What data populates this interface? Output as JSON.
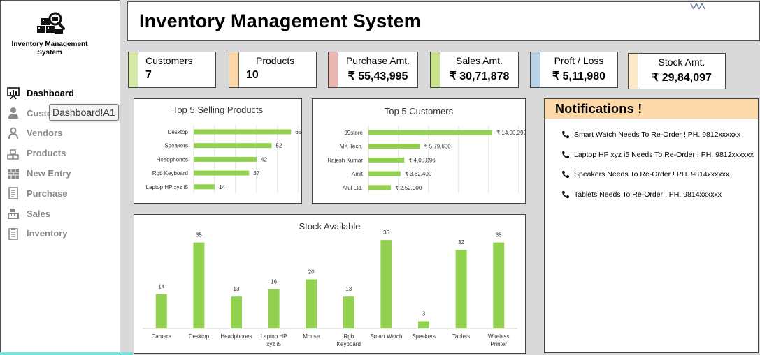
{
  "app": {
    "title": "Inventory Management System",
    "brand": "Inventory Management System"
  },
  "sidebar": {
    "items": [
      {
        "label": "Dashboard",
        "icon": "dashboard-icon",
        "active": true
      },
      {
        "label": "Customers",
        "icon": "person-icon",
        "active": false
      },
      {
        "label": "Vendors",
        "icon": "vendor-icon",
        "active": false
      },
      {
        "label": "Products",
        "icon": "boxes-icon",
        "active": false
      },
      {
        "label": "New Entry",
        "icon": "brick-icon",
        "active": false
      },
      {
        "label": "Purchase",
        "icon": "document-icon",
        "active": false
      },
      {
        "label": "Sales",
        "icon": "cash-register-icon",
        "active": false
      },
      {
        "label": "Inventory",
        "icon": "clipboard-icon",
        "active": false
      }
    ],
    "tooltip": "Dashboard!A1"
  },
  "kpis": [
    {
      "label": "Customers",
      "value": "7",
      "color": "#d6e9a6"
    },
    {
      "label": "Products",
      "value": "10",
      "color": "#fcd8a8"
    },
    {
      "label": "Purchase Amt.",
      "value": "₹ 55,43,995",
      "color": "#ecb7b0"
    },
    {
      "label": "Sales Amt.",
      "value": "₹ 30,71,878",
      "color": "#c9e38b"
    },
    {
      "label": "Proft / Loss",
      "value": "₹ 5,11,980",
      "color": "#b7d1e6"
    },
    {
      "label": "Stock Amt.",
      "value": "₹ 29,84,097",
      "color": "#fde9c8"
    }
  ],
  "notifications": {
    "title": "Notifications !",
    "items": [
      "Smart Watch Needs To Re-Order ! PH. 9812xxxxxx",
      "Laptop HP xyz i5 Needs To Re-Order ! PH. 9812xxxxxx",
      "Speakers Needs To Re-Order ! PH. 9814xxxxxx",
      "Tablets Needs To Re-Order ! PH. 9814xxxxxx"
    ]
  },
  "colors": {
    "bar": "#92d050"
  },
  "chart_data": [
    {
      "type": "bar",
      "orientation": "horizontal",
      "title": "Top 5 Selling Products",
      "categories": [
        "Desktop",
        "Speakers",
        "Headphones",
        "Rgb Keyboard",
        "Laptop HP xyz i5"
      ],
      "values": [
        65,
        52,
        42,
        37,
        14
      ],
      "data_labels": [
        "65",
        "52",
        "42",
        "37",
        "14"
      ],
      "xlim": [
        0,
        70
      ],
      "grid": true
    },
    {
      "type": "bar",
      "orientation": "horizontal",
      "title": "Top 5 Customers",
      "categories": [
        "99store",
        "MK Tech.",
        "Rajesh Kumar",
        "Amit",
        "Atul Ltd."
      ],
      "values": [
        1400292,
        579600,
        405096,
        362400,
        252000
      ],
      "data_labels": [
        "₹ 14,00,292",
        "₹ 5,79,600",
        "₹ 4,05,096",
        "₹ 3,62,400",
        "₹ 2,52,000"
      ],
      "xlim": [
        0,
        1700000
      ],
      "grid": true
    },
    {
      "type": "bar",
      "orientation": "vertical",
      "title": "Stock Available",
      "categories": [
        "Camera",
        "Desktop",
        "Headphones",
        "Laptop HP xyz i5",
        "Mouse",
        "Rgb Keyboard",
        "Smart Watch",
        "Speakers",
        "Tablets",
        "Wireless Printer"
      ],
      "category_lines": [
        [
          "Camera"
        ],
        [
          "Desktop"
        ],
        [
          "Headphones"
        ],
        [
          "Laptop HP",
          "xyz i5"
        ],
        [
          "Mouse"
        ],
        [
          "Rgb",
          "Keyboard"
        ],
        [
          "Smart Watch"
        ],
        [
          "Speakers"
        ],
        [
          "Tablets"
        ],
        [
          "Wireless",
          "Printer"
        ]
      ],
      "values": [
        14,
        35,
        13,
        16,
        20,
        13,
        36,
        3,
        32,
        35
      ],
      "ylim": [
        0,
        40
      ],
      "grid": false
    }
  ]
}
